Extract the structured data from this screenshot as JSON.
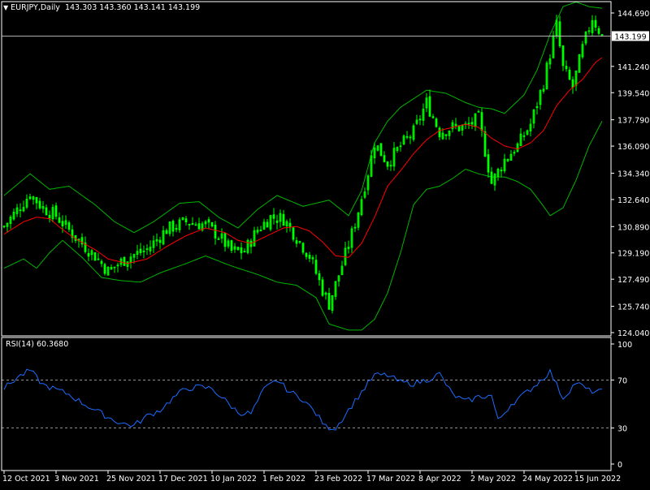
{
  "header": {
    "symbol": "EURJPY,Daily",
    "ohlc": "143.303 143.360 143.141 143.199",
    "arrow_icon": "triangle-down-icon"
  },
  "rsi_header": "RSI(14) 60.3680",
  "current_price_label": "143.199",
  "colors": {
    "background": "#000000",
    "candle": "#00ff00",
    "bollinger": "#00b400",
    "moving_average": "#ff0000",
    "rsi_line": "#1e6bff",
    "frame": "#ffffff",
    "level_line": "#c0c0c0"
  },
  "chart_data": [
    {
      "name": "price",
      "type": "line",
      "ylim": [
        124.04,
        145.4
      ],
      "y_ticks": [
        "144.690",
        "141.240",
        "139.540",
        "137.790",
        "136.090",
        "134.340",
        "132.640",
        "130.890",
        "129.190",
        "127.490",
        "125.740",
        "124.040"
      ],
      "ytick_values": [
        144.69,
        141.24,
        139.54,
        137.79,
        136.09,
        134.34,
        132.64,
        130.89,
        129.19,
        127.49,
        125.74,
        124.04
      ],
      "x_ticks": [
        "12 Oct 2021",
        "3 Nov 2021",
        "25 Nov 2021",
        "17 Dec 2021",
        "10 Jan 2022",
        "1 Feb 2022",
        "23 Feb 2022",
        "17 Mar 2022",
        "8 Apr 2022",
        "2 May 2022",
        "24 May 2022",
        "15 Jun 2022"
      ],
      "xtick_bars": [
        0,
        16,
        32,
        48,
        64,
        80,
        96,
        112,
        128,
        144,
        160,
        176
      ],
      "bar_count": 185,
      "current_price": 143.199,
      "close_anchors": [
        [
          0,
          130.9
        ],
        [
          8,
          133.0
        ],
        [
          12,
          132.1
        ],
        [
          16,
          131.6
        ],
        [
          22,
          130.2
        ],
        [
          28,
          129.0
        ],
        [
          32,
          128.0
        ],
        [
          38,
          128.9
        ],
        [
          44,
          129.4
        ],
        [
          50,
          130.7
        ],
        [
          56,
          131.2
        ],
        [
          62,
          131.0
        ],
        [
          66,
          130.3
        ],
        [
          70,
          129.3
        ],
        [
          74,
          129.3
        ],
        [
          78,
          130.7
        ],
        [
          82,
          131.5
        ],
        [
          86,
          131.4
        ],
        [
          90,
          130.2
        ],
        [
          94,
          129.0
        ],
        [
          98,
          126.8
        ],
        [
          100,
          125.9
        ],
        [
          104,
          128.4
        ],
        [
          108,
          131.1
        ],
        [
          112,
          134.4
        ],
        [
          114,
          136.3
        ],
        [
          118,
          135.0
        ],
        [
          122,
          136.1
        ],
        [
          126,
          137.0
        ],
        [
          130,
          138.9
        ],
        [
          134,
          137.0
        ],
        [
          138,
          137.3
        ],
        [
          142,
          137.3
        ],
        [
          146,
          137.9
        ],
        [
          150,
          133.7
        ],
        [
          154,
          135.2
        ],
        [
          158,
          136.1
        ],
        [
          162,
          137.5
        ],
        [
          166,
          140.2
        ],
        [
          170,
          143.9
        ],
        [
          172,
          141.1
        ],
        [
          175,
          139.9
        ],
        [
          178,
          142.4
        ],
        [
          181,
          144.4
        ],
        [
          184,
          143.2
        ]
      ],
      "bollinger_upper_anchors": [
        [
          0,
          132.9
        ],
        [
          8,
          134.3
        ],
        [
          14,
          133.3
        ],
        [
          20,
          133.5
        ],
        [
          28,
          132.3
        ],
        [
          34,
          131.2
        ],
        [
          40,
          130.5
        ],
        [
          46,
          131.2
        ],
        [
          54,
          132.4
        ],
        [
          60,
          132.5
        ],
        [
          66,
          131.5
        ],
        [
          72,
          130.8
        ],
        [
          78,
          132.0
        ],
        [
          84,
          132.9
        ],
        [
          92,
          132.2
        ],
        [
          100,
          132.6
        ],
        [
          106,
          131.6
        ],
        [
          110,
          133.2
        ],
        [
          114,
          136.3
        ],
        [
          118,
          137.7
        ],
        [
          122,
          138.6
        ],
        [
          130,
          139.7
        ],
        [
          136,
          139.5
        ],
        [
          142,
          138.9
        ],
        [
          146,
          138.6
        ],
        [
          150,
          138.5
        ],
        [
          154,
          138.2
        ],
        [
          160,
          139.4
        ],
        [
          164,
          141.0
        ],
        [
          168,
          143.3
        ],
        [
          172,
          145.1
        ],
        [
          176,
          145.4
        ],
        [
          180,
          145.1
        ],
        [
          184,
          145.0
        ]
      ],
      "bollinger_lower_anchors": [
        [
          0,
          128.2
        ],
        [
          6,
          128.8
        ],
        [
          10,
          128.2
        ],
        [
          14,
          129.2
        ],
        [
          18,
          130.0
        ],
        [
          24,
          128.9
        ],
        [
          30,
          127.6
        ],
        [
          36,
          127.4
        ],
        [
          42,
          127.3
        ],
        [
          48,
          127.9
        ],
        [
          56,
          128.5
        ],
        [
          62,
          129.0
        ],
        [
          68,
          128.5
        ],
        [
          72,
          128.2
        ],
        [
          78,
          127.8
        ],
        [
          84,
          127.3
        ],
        [
          90,
          127.1
        ],
        [
          96,
          126.3
        ],
        [
          100,
          124.6
        ],
        [
          106,
          124.2
        ],
        [
          110,
          124.2
        ],
        [
          114,
          124.9
        ],
        [
          118,
          126.6
        ],
        [
          122,
          129.2
        ],
        [
          126,
          132.3
        ],
        [
          130,
          133.3
        ],
        [
          134,
          133.5
        ],
        [
          138,
          134.0
        ],
        [
          142,
          134.6
        ],
        [
          146,
          134.3
        ],
        [
          150,
          134.1
        ],
        [
          154,
          134.1
        ],
        [
          158,
          133.8
        ],
        [
          162,
          133.3
        ],
        [
          166,
          132.2
        ],
        [
          168,
          131.6
        ],
        [
          172,
          132.1
        ],
        [
          176,
          133.9
        ],
        [
          180,
          136.1
        ],
        [
          184,
          137.7
        ]
      ],
      "moving_average_anchors": [
        [
          0,
          130.4
        ],
        [
          6,
          131.2
        ],
        [
          10,
          131.5
        ],
        [
          14,
          131.4
        ],
        [
          18,
          130.7
        ],
        [
          22,
          130.1
        ],
        [
          28,
          129.4
        ],
        [
          32,
          128.8
        ],
        [
          38,
          128.5
        ],
        [
          44,
          128.8
        ],
        [
          50,
          129.6
        ],
        [
          56,
          130.3
        ],
        [
          62,
          130.8
        ],
        [
          68,
          130.5
        ],
        [
          72,
          130.0
        ],
        [
          76,
          129.8
        ],
        [
          80,
          130.2
        ],
        [
          86,
          130.8
        ],
        [
          90,
          130.9
        ],
        [
          94,
          130.6
        ],
        [
          98,
          129.9
        ],
        [
          102,
          129.0
        ],
        [
          106,
          128.9
        ],
        [
          110,
          129.8
        ],
        [
          114,
          131.5
        ],
        [
          118,
          133.5
        ],
        [
          122,
          134.5
        ],
        [
          126,
          135.6
        ],
        [
          130,
          136.5
        ],
        [
          134,
          137.1
        ],
        [
          138,
          137.3
        ],
        [
          142,
          137.5
        ],
        [
          146,
          137.3
        ],
        [
          150,
          136.6
        ],
        [
          154,
          136.1
        ],
        [
          158,
          135.9
        ],
        [
          162,
          136.3
        ],
        [
          166,
          137.1
        ],
        [
          170,
          138.7
        ],
        [
          174,
          139.7
        ],
        [
          178,
          140.4
        ],
        [
          182,
          141.5
        ],
        [
          184,
          141.8
        ]
      ]
    },
    {
      "name": "RSI(14)",
      "type": "line",
      "ylim": [
        0,
        100
      ],
      "y_ticks": [
        "100",
        "70",
        "30",
        "0"
      ],
      "ytick_values": [
        100,
        70,
        30,
        0
      ],
      "levels": [
        70,
        30
      ],
      "anchors": [
        [
          0,
          63
        ],
        [
          4,
          72
        ],
        [
          8,
          78
        ],
        [
          12,
          66
        ],
        [
          16,
          62
        ],
        [
          20,
          58
        ],
        [
          24,
          51
        ],
        [
          28,
          45
        ],
        [
          32,
          39
        ],
        [
          36,
          34
        ],
        [
          40,
          32
        ],
        [
          44,
          40
        ],
        [
          48,
          45
        ],
        [
          52,
          55
        ],
        [
          56,
          63
        ],
        [
          60,
          64
        ],
        [
          64,
          63
        ],
        [
          68,
          53
        ],
        [
          72,
          43
        ],
        [
          76,
          42
        ],
        [
          80,
          62
        ],
        [
          84,
          70
        ],
        [
          88,
          60
        ],
        [
          92,
          54
        ],
        [
          96,
          42
        ],
        [
          99,
          31
        ],
        [
          102,
          30
        ],
        [
          106,
          45
        ],
        [
          110,
          60
        ],
        [
          114,
          74
        ],
        [
          118,
          74
        ],
        [
          122,
          68
        ],
        [
          126,
          67
        ],
        [
          130,
          70
        ],
        [
          134,
          75
        ],
        [
          138,
          58
        ],
        [
          142,
          52
        ],
        [
          146,
          56
        ],
        [
          150,
          57
        ],
        [
          152,
          36
        ],
        [
          156,
          50
        ],
        [
          160,
          58
        ],
        [
          164,
          67
        ],
        [
          168,
          77
        ],
        [
          172,
          55
        ],
        [
          176,
          68
        ],
        [
          180,
          61
        ],
        [
          184,
          60
        ]
      ]
    }
  ]
}
